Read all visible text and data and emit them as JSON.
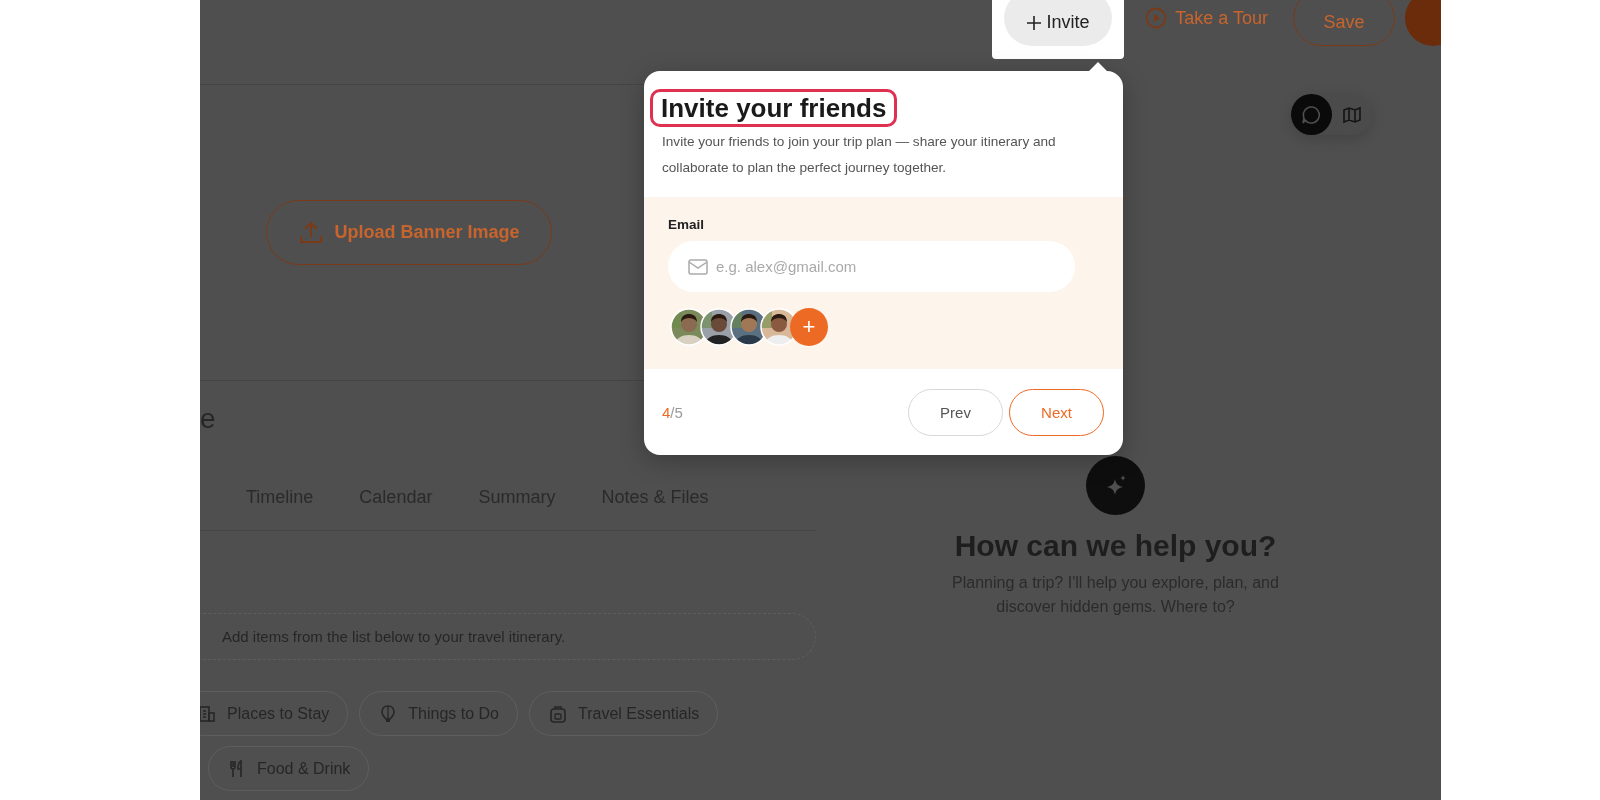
{
  "top_bar": {
    "invite_button": {
      "label": "Invite"
    },
    "tour_button": {
      "label": "Take a Tour"
    },
    "save_button": {
      "label": "Save"
    }
  },
  "banner": {
    "upload_button": {
      "label": "Upload Banner Image"
    }
  },
  "trip_title": "e",
  "tabs": [
    {
      "label": "Timeline",
      "selected": false
    },
    {
      "label": "Calendar",
      "selected": false
    },
    {
      "label": "Summary",
      "selected": false
    },
    {
      "label": "Notes & Files",
      "selected": false
    }
  ],
  "itinerary": {
    "hint": "Add items from the list below to your travel itinerary.",
    "categories": [
      {
        "label": "Places to Stay"
      },
      {
        "label": "Things to Do"
      },
      {
        "label": "Travel Essentials"
      },
      {
        "label": "Food & Drink"
      }
    ]
  },
  "view_toggle": [
    {
      "selected": true
    },
    {
      "selected": false
    }
  ],
  "assistant": {
    "heading": "How can we help you?",
    "text": "Planning a trip? I'll help you explore, plan, and discover hidden gems. Where to?"
  },
  "tour_popup": {
    "title": "Invite your friends",
    "title_highlighted": true,
    "description": "Invite your friends to join your trip plan — share your itinerary and collaborate to plan the perfect journey together.",
    "email": {
      "label": "Email",
      "placeholder": "e.g. alex@gmail.com"
    },
    "add_button": "+",
    "step_current": "4",
    "step_rest": "/5",
    "prev_button": "Prev",
    "next_button": "Next"
  }
}
